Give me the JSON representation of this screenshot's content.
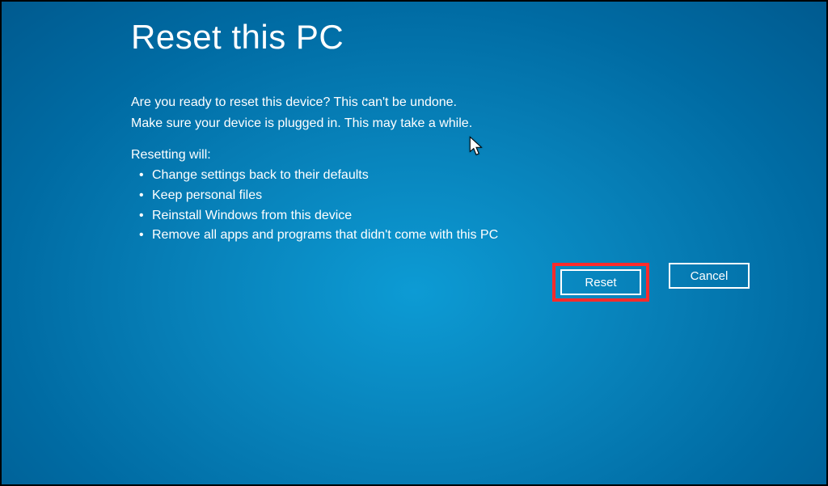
{
  "title": "Reset this PC",
  "intro": {
    "line1": "Are you ready to reset this device? This can't be undone.",
    "line2": "Make sure your device is plugged in. This may take a while."
  },
  "list_heading": "Resetting will:",
  "list_items": {
    "item1": "Change settings back to their defaults",
    "item2": "Keep personal files",
    "item3": "Reinstall Windows from this device",
    "item4": "Remove all apps and programs that didn't come with this PC"
  },
  "buttons": {
    "reset": "Reset",
    "cancel": "Cancel"
  }
}
